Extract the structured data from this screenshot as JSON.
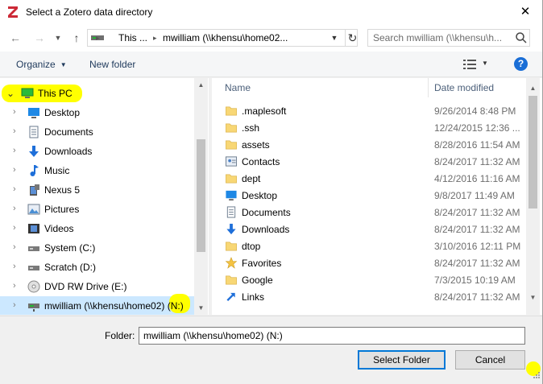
{
  "window": {
    "title": "Select a Zotero data directory",
    "close_label": "✕",
    "app_icon_letter": "Z",
    "app_icon_color": "#cc2936"
  },
  "address": {
    "crumb_parts": [
      "This ...",
      "mwilliam (\\\\khensu\\home02..."
    ],
    "search_placeholder": "Search mwilliam (\\\\khensu\\h..."
  },
  "toolbar": {
    "organize_label": "Organize",
    "new_folder_label": "New folder",
    "help_label": "?"
  },
  "nav_pane": {
    "items": [
      {
        "label": "This PC",
        "icon": "computer-icon",
        "expanded": true,
        "highlighted": true
      },
      {
        "label": "Desktop",
        "icon": "desktop-icon"
      },
      {
        "label": "Documents",
        "icon": "documents-icon"
      },
      {
        "label": "Downloads",
        "icon": "downloads-icon"
      },
      {
        "label": "Music",
        "icon": "music-icon"
      },
      {
        "label": "Nexus 5",
        "icon": "phone-icon"
      },
      {
        "label": "Pictures",
        "icon": "pictures-icon"
      },
      {
        "label": "Videos",
        "icon": "videos-icon"
      },
      {
        "label": "System (C:)",
        "icon": "drive-icon"
      },
      {
        "label": "Scratch (D:)",
        "icon": "drive-icon"
      },
      {
        "label": "DVD RW Drive (E:)",
        "icon": "dvd-icon"
      },
      {
        "label": "mwilliam (\\\\khensu\\home02) (N:)",
        "icon": "network-drive-icon",
        "selected": true,
        "highlighted_part": "(N:)"
      }
    ],
    "highlight_color": "#ffff00",
    "selection_color": "#cce8ff"
  },
  "file_list": {
    "columns": [
      "Name",
      "Date modified"
    ],
    "rows": [
      {
        "name": ".maplesoft",
        "date": "9/26/2014 8:48 PM",
        "icon": "folder-icon"
      },
      {
        "name": ".ssh",
        "date": "12/24/2015 12:36 ...",
        "icon": "folder-icon"
      },
      {
        "name": "assets",
        "date": "8/28/2016 11:54 AM",
        "icon": "folder-icon"
      },
      {
        "name": "Contacts",
        "date": "8/24/2017 11:32 AM",
        "icon": "contacts-icon"
      },
      {
        "name": "dept",
        "date": "4/12/2016 11:16 AM",
        "icon": "folder-icon"
      },
      {
        "name": "Desktop",
        "date": "9/8/2017 11:49 AM",
        "icon": "desktop-icon"
      },
      {
        "name": "Documents",
        "date": "8/24/2017 11:32 AM",
        "icon": "documents-icon"
      },
      {
        "name": "Downloads",
        "date": "8/24/2017 11:32 AM",
        "icon": "downloads-icon"
      },
      {
        "name": "dtop",
        "date": "3/10/2016 12:11 PM",
        "icon": "folder-icon"
      },
      {
        "name": "Favorites",
        "date": "8/24/2017 11:32 AM",
        "icon": "favorites-icon"
      },
      {
        "name": "Google",
        "date": "7/3/2015 10:19 AM",
        "icon": "folder-icon"
      },
      {
        "name": "Links",
        "date": "8/24/2017 11:32 AM",
        "icon": "links-icon"
      }
    ]
  },
  "footer": {
    "folder_label": "Folder:",
    "folder_value": "mwilliam (\\\\khensu\\home02) (N:)",
    "select_button": "Select Folder",
    "cancel_button": "Cancel"
  }
}
